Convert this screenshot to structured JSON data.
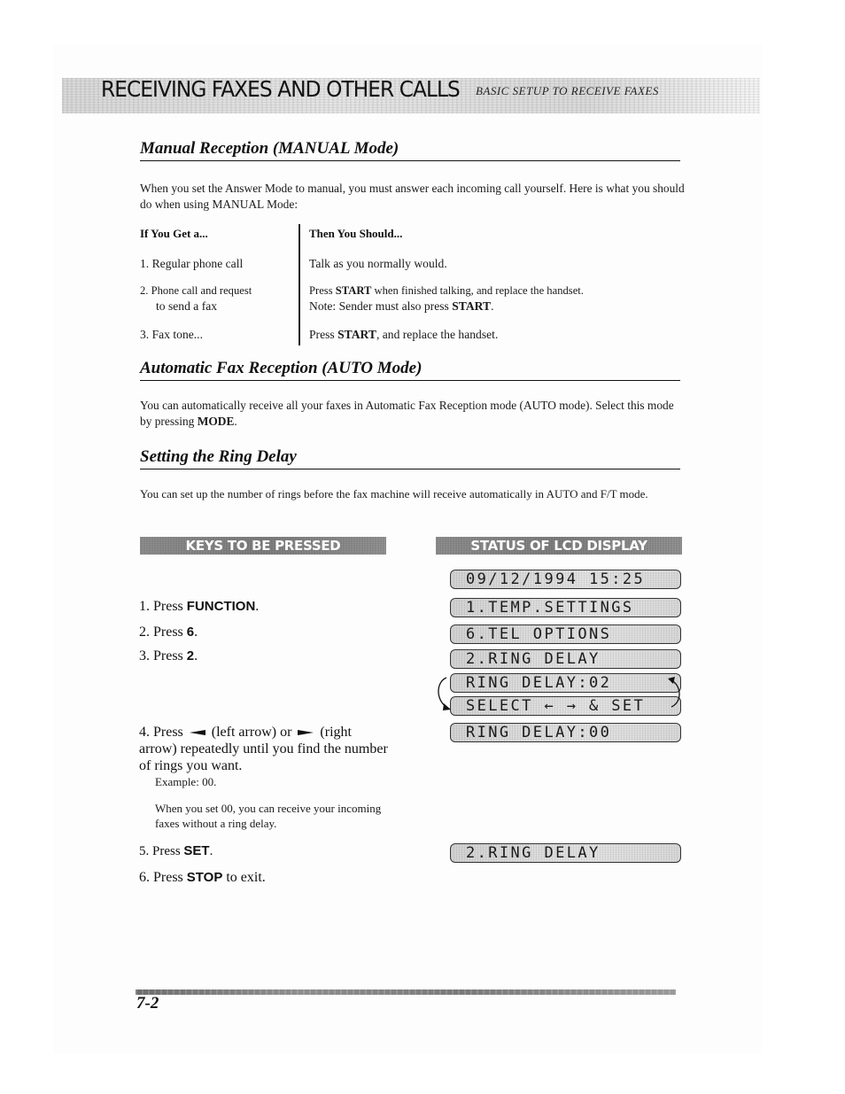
{
  "header": {
    "chapter_title": "RECEIVING FAXES AND OTHER CALLS",
    "section_subtitle": "BASIC SETUP TO RECEIVE FAXES"
  },
  "manual_reception": {
    "heading": "Manual Reception (MANUAL Mode)",
    "intro": "When you set the Answer Mode to manual, you must answer each incoming call yourself.  Here is what you should do when using MANUAL Mode:",
    "table": {
      "col_if": "If You Get a...",
      "col_then": "Then You Should...",
      "rows": [
        {
          "if_line1": "1. Regular phone call",
          "if_line2": "",
          "then_line1_pre": "Talk as you normally would.",
          "then_line1_bold": "",
          "then_line1_post": "",
          "then_line2_pre": "",
          "then_line2_bold": "",
          "then_line2_post": ""
        },
        {
          "if_line1": "2. Phone call and request",
          "if_line2": "to send a fax",
          "then_line1_pre": "Press ",
          "then_line1_bold": "START",
          "then_line1_post": " when finished talking, and replace the handset.",
          "then_line2_pre": "Note: Sender must also press ",
          "then_line2_bold": "START",
          "then_line2_post": "."
        },
        {
          "if_line1": "3. Fax tone...",
          "if_line2": "",
          "then_line1_pre": "Press ",
          "then_line1_bold": "START",
          "then_line1_post": ", and replace the handset.",
          "then_line2_pre": "",
          "then_line2_bold": "",
          "then_line2_post": ""
        }
      ]
    }
  },
  "auto_reception": {
    "heading": "Automatic Fax Reception (AUTO Mode)",
    "text_pre": "You can automatically receive all your faxes in Automatic Fax Reception mode (AUTO mode). Select this mode by pressing ",
    "text_bold": "MODE",
    "text_post": "."
  },
  "ring_delay": {
    "heading": "Setting the Ring Delay",
    "intro": "You can set up the number of rings before the fax machine will receive automatically in AUTO and F/T mode.",
    "keys_banner": "KEYS TO BE PRESSED",
    "lcd_banner": "STATUS OF LCD DISPLAY",
    "steps": [
      {
        "pre": "1. Press ",
        "key": "FUNCTION",
        "post": "."
      },
      {
        "pre": "2. Press ",
        "key": "6",
        "post": "."
      },
      {
        "pre": "3. Press ",
        "key": "2",
        "post": "."
      },
      {
        "pre": "4. Press ",
        "left_label": " (left arrow) or ",
        "right_label": " (right arrow) repeatedly until you find the number of rings you want."
      },
      {
        "pre": "5. Press ",
        "key": "SET",
        "post": "."
      },
      {
        "pre": "6. Press ",
        "key": "STOP",
        "post": " to exit."
      }
    ],
    "step4_example": "Example: 00.",
    "step4_note": "When you set 00, you can receive your incoming faxes without a ring delay.",
    "lcd_screens": [
      "09/12/1994 15:25",
      "1.TEMP.SETTINGS",
      "6.TEL OPTIONS",
      "2.RING DELAY",
      "RING DELAY:02",
      "SELECT ← → & SET",
      "RING DELAY:00",
      "2.RING DELAY"
    ],
    "icons": {
      "left_arrow_key": "left-arrow-key-icon",
      "right_arrow_key": "right-arrow-key-icon",
      "alternating_loop": "alternating-display-loop-icon"
    }
  },
  "footer": {
    "page_number": "7-2"
  }
}
